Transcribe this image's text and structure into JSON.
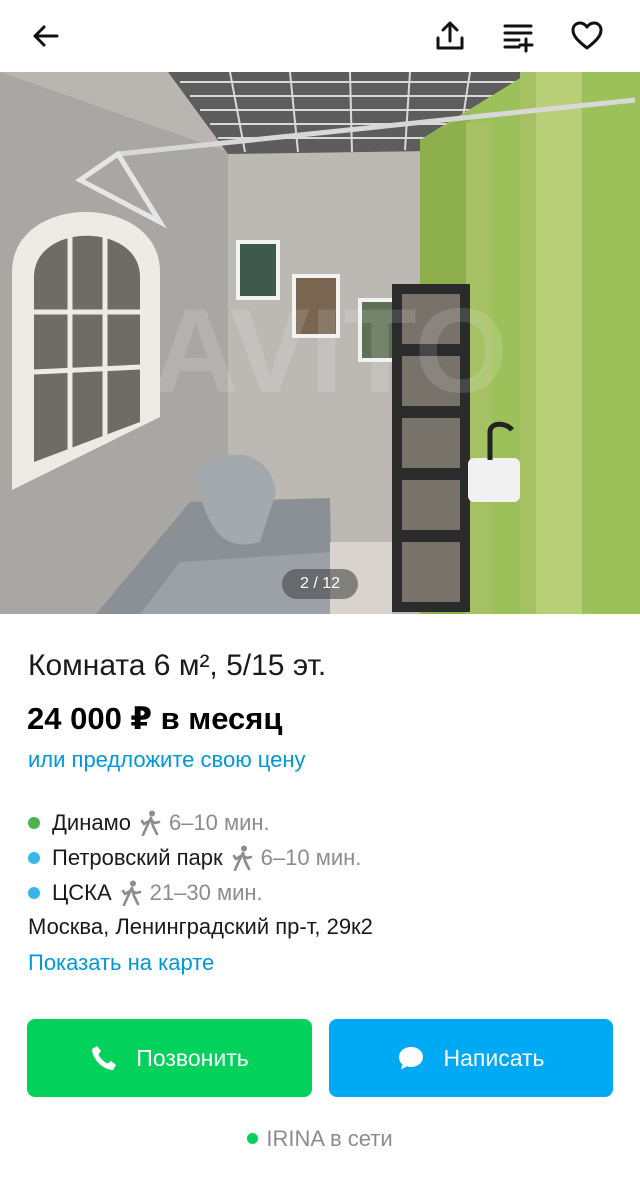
{
  "header": {
    "back_icon": "arrow-left-icon",
    "share_icon": "share-icon",
    "notes_icon": "add-note-icon",
    "favorite_icon": "heart-icon"
  },
  "gallery": {
    "counter": "2 / 12"
  },
  "listing": {
    "title": "Комната 6 м², 5/15 эт.",
    "price": "24 000 ₽ в месяц",
    "offer_link": "или предложите свою цену"
  },
  "metro": [
    {
      "name": "Динамо",
      "time": "6–10 мин.",
      "color": "#4fb04e"
    },
    {
      "name": "Петровский парк",
      "time": "6–10 мин.",
      "color": "#38b6ea"
    },
    {
      "name": "ЦСКА",
      "time": "21–30 мин.",
      "color": "#38b6ea"
    }
  ],
  "address": "Москва, Ленинградский пр-т, 29к2",
  "map_link": "Показать на карте",
  "actions": {
    "call_label": "Позвонить",
    "message_label": "Написать",
    "call_color": "#02d15c",
    "message_color": "#00a9f4"
  },
  "seller": {
    "name": "IRINA",
    "status": "в сети"
  }
}
